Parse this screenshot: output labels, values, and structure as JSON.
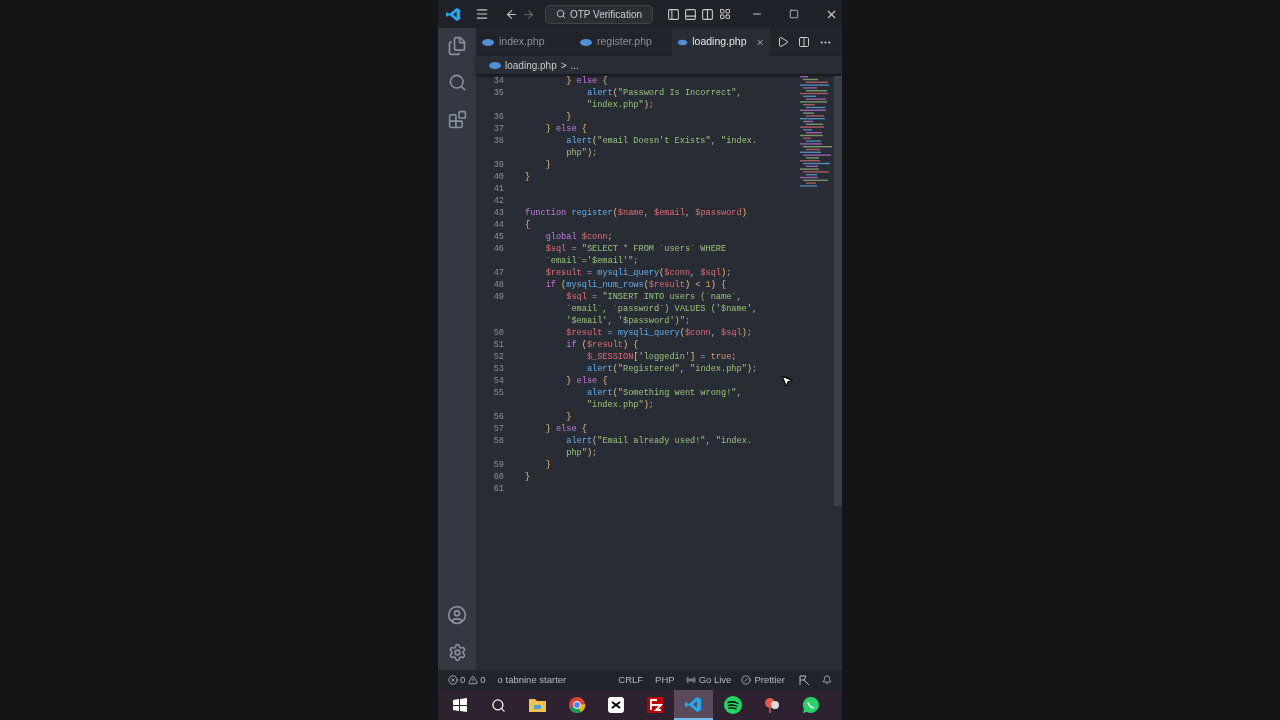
{
  "title_bar": {
    "search": "OTP Verification"
  },
  "tabs": [
    {
      "label": "index.php",
      "selected": false
    },
    {
      "label": "register.php",
      "selected": false
    },
    {
      "label": "loading.php",
      "selected": true
    }
  ],
  "breadcrumb": {
    "file": "loading.php",
    "separator": ">",
    "rest": "..."
  },
  "code_lines": [
    {
      "number": "34",
      "tokens": [
        {
          "kind": "bracket",
          "text": "        } "
        },
        {
          "kind": "keyword",
          "text": "else"
        },
        {
          "kind": "bracket",
          "text": " {"
        }
      ]
    },
    {
      "number": "35",
      "tokens": [
        {
          "kind": "function",
          "text": "            alert"
        },
        {
          "kind": "bracket",
          "text": "("
        },
        {
          "kind": "string",
          "text": "\"Password Is Incorrect\""
        },
        {
          "kind": "punct",
          "text": ","
        }
      ]
    },
    {
      "tokens": [
        {
          "kind": "string",
          "text": "            \"index.php\""
        },
        {
          "kind": "bracket",
          "text": ")"
        },
        {
          "kind": "punct",
          "text": ";"
        }
      ]
    },
    {
      "number": "36",
      "tokens": [
        {
          "kind": "bracket",
          "text": "        }"
        }
      ]
    },
    {
      "number": "37",
      "tokens": [
        {
          "kind": "bracket",
          "text": "    } "
        },
        {
          "kind": "keyword",
          "text": "else"
        },
        {
          "kind": "bracket",
          "text": " {"
        }
      ]
    },
    {
      "number": "38",
      "tokens": [
        {
          "kind": "function",
          "text": "        alert"
        },
        {
          "kind": "bracket",
          "text": "("
        },
        {
          "kind": "string",
          "text": "\"email Doesn't Exists\""
        },
        {
          "kind": "punct",
          "text": ", "
        },
        {
          "kind": "string",
          "text": "\"index."
        }
      ]
    },
    {
      "tokens": [
        {
          "kind": "string",
          "text": "        php\""
        },
        {
          "kind": "bracket",
          "text": ")"
        },
        {
          "kind": "punct",
          "text": ";"
        }
      ]
    },
    {
      "number": "39",
      "tokens": [
        {
          "kind": "bracket",
          "text": "    }"
        }
      ]
    },
    {
      "number": "40",
      "tokens": [
        {
          "kind": "bracket",
          "text": "}"
        }
      ]
    },
    {
      "number": "41"
    },
    {
      "number": "42"
    },
    {
      "number": "43",
      "tokens": [
        {
          "kind": "keyword",
          "text": "function "
        },
        {
          "kind": "function",
          "text": "register"
        },
        {
          "kind": "bracket",
          "text": "("
        },
        {
          "kind": "variable",
          "text": "$name"
        },
        {
          "kind": "punct",
          "text": ", "
        },
        {
          "kind": "variable",
          "text": "$email"
        },
        {
          "kind": "punct",
          "text": ", "
        },
        {
          "kind": "variable",
          "text": "$password"
        },
        {
          "kind": "bracket",
          "text": ")"
        }
      ]
    },
    {
      "number": "44",
      "tokens": [
        {
          "kind": "bracket",
          "text": "{"
        }
      ]
    },
    {
      "number": "45",
      "tokens": [
        {
          "kind": "keyword",
          "text": "    global "
        },
        {
          "kind": "variable",
          "text": "$conn"
        },
        {
          "kind": "punct",
          "text": ";"
        }
      ]
    },
    {
      "number": "46",
      "tokens": [
        {
          "kind": "variable",
          "text": "    $sql"
        },
        {
          "kind": "punct",
          "text": " = "
        },
        {
          "kind": "string",
          "text": "\"SELECT * FROM `users` WHERE"
        }
      ]
    },
    {
      "tokens": [
        {
          "kind": "string",
          "text": "    `email`='$email'\""
        },
        {
          "kind": "punct",
          "text": ";"
        }
      ]
    },
    {
      "number": "47",
      "tokens": [
        {
          "kind": "variable",
          "text": "    $result"
        },
        {
          "kind": "punct",
          "text": " = "
        },
        {
          "kind": "function",
          "text": "mysqli_query"
        },
        {
          "kind": "bracket",
          "text": "("
        },
        {
          "kind": "variable",
          "text": "$conn"
        },
        {
          "kind": "punct",
          "text": ", "
        },
        {
          "kind": "variable",
          "text": "$sql"
        },
        {
          "kind": "bracket",
          "text": ")"
        },
        {
          "kind": "punct",
          "text": ";"
        }
      ]
    },
    {
      "number": "48",
      "tokens": [
        {
          "kind": "keyword",
          "text": "    if "
        },
        {
          "kind": "bracket",
          "text": "("
        },
        {
          "kind": "function",
          "text": "mysqli_num_rows"
        },
        {
          "kind": "bracket",
          "text": "("
        },
        {
          "kind": "variable",
          "text": "$result"
        },
        {
          "kind": "bracket",
          "text": ")"
        },
        {
          "kind": "punct",
          "text": " < "
        },
        {
          "kind": "constant",
          "text": "1"
        },
        {
          "kind": "bracket",
          "text": ") {"
        }
      ]
    },
    {
      "number": "49",
      "tokens": [
        {
          "kind": "variable",
          "text": "        $sql"
        },
        {
          "kind": "punct",
          "text": " = "
        },
        {
          "kind": "string",
          "text": "\"INSERT INTO users (`name`,"
        }
      ]
    },
    {
      "tokens": [
        {
          "kind": "string",
          "text": "        `email`, `password`) VALUES ('$name',"
        }
      ]
    },
    {
      "tokens": [
        {
          "kind": "string",
          "text": "        '$email', '$password')\""
        },
        {
          "kind": "punct",
          "text": ";"
        }
      ]
    },
    {
      "number": "50",
      "tokens": [
        {
          "kind": "variable",
          "text": "        $result"
        },
        {
          "kind": "punct",
          "text": " = "
        },
        {
          "kind": "function",
          "text": "mysqli_query"
        },
        {
          "kind": "bracket",
          "text": "("
        },
        {
          "kind": "variable",
          "text": "$conn"
        },
        {
          "kind": "punct",
          "text": ", "
        },
        {
          "kind": "variable",
          "text": "$sql"
        },
        {
          "kind": "bracket",
          "text": ")"
        },
        {
          "kind": "punct",
          "text": ";"
        }
      ]
    },
    {
      "number": "51",
      "tokens": [
        {
          "kind": "keyword",
          "text": "        if "
        },
        {
          "kind": "bracket",
          "text": "("
        },
        {
          "kind": "variable",
          "text": "$result"
        },
        {
          "kind": "bracket",
          "text": ") {"
        }
      ]
    },
    {
      "number": "52",
      "tokens": [
        {
          "kind": "variable",
          "text": "            $_SESSION"
        },
        {
          "kind": "bracket",
          "text": "["
        },
        {
          "kind": "string",
          "text": "'loggedin'"
        },
        {
          "kind": "bracket",
          "text": "]"
        },
        {
          "kind": "punct",
          "text": " = "
        },
        {
          "kind": "constant",
          "text": "true"
        },
        {
          "kind": "punct",
          "text": ";"
        }
      ]
    },
    {
      "number": "53",
      "tokens": [
        {
          "kind": "function",
          "text": "            alert"
        },
        {
          "kind": "bracket",
          "text": "("
        },
        {
          "kind": "string",
          "text": "\"Registered\""
        },
        {
          "kind": "punct",
          "text": ", "
        },
        {
          "kind": "string",
          "text": "\"index.php\""
        },
        {
          "kind": "bracket",
          "text": ")"
        },
        {
          "kind": "punct",
          "text": ";"
        }
      ]
    },
    {
      "number": "54",
      "tokens": [
        {
          "kind": "bracket",
          "text": "        } "
        },
        {
          "kind": "keyword",
          "text": "else"
        },
        {
          "kind": "bracket",
          "text": " {"
        }
      ]
    },
    {
      "number": "55",
      "tokens": [
        {
          "kind": "function",
          "text": "            alert"
        },
        {
          "kind": "bracket",
          "text": "("
        },
        {
          "kind": "string",
          "text": "\"Something went wrong!\""
        },
        {
          "kind": "punct",
          "text": ","
        }
      ]
    },
    {
      "tokens": [
        {
          "kind": "string",
          "text": "            \"index.php\""
        },
        {
          "kind": "bracket",
          "text": ")"
        },
        {
          "kind": "punct",
          "text": ";"
        }
      ]
    },
    {
      "number": "56",
      "tokens": [
        {
          "kind": "bracket",
          "text": "        }"
        }
      ]
    },
    {
      "number": "57",
      "tokens": [
        {
          "kind": "bracket",
          "text": "    } "
        },
        {
          "kind": "keyword",
          "text": "else"
        },
        {
          "kind": "bracket",
          "text": " {"
        }
      ]
    },
    {
      "number": "58",
      "tokens": [
        {
          "kind": "function",
          "text": "        alert"
        },
        {
          "kind": "bracket",
          "text": "("
        },
        {
          "kind": "string",
          "text": "\"Email already used!\""
        },
        {
          "kind": "punct",
          "text": ", "
        },
        {
          "kind": "string",
          "text": "\"index."
        }
      ]
    },
    {
      "tokens": [
        {
          "kind": "string",
          "text": "        php\""
        },
        {
          "kind": "bracket",
          "text": ")"
        },
        {
          "kind": "punct",
          "text": ";"
        }
      ]
    },
    {
      "number": "59",
      "tokens": [
        {
          "kind": "bracket",
          "text": "    }"
        }
      ]
    },
    {
      "number": "60",
      "tokens": [
        {
          "kind": "bracket",
          "text": "}"
        }
      ]
    },
    {
      "number": "61"
    }
  ],
  "status_bar": {
    "errors": "0",
    "warnings": "0",
    "tabnine": "o tabnine starter",
    "line_ending": "CRLF",
    "language": "PHP",
    "go_live": "Go Live",
    "prettier": "Prettier"
  },
  "taskbar": [
    {
      "kind": "windows",
      "selected": false
    },
    {
      "kind": "search",
      "selected": false
    },
    {
      "kind": "folder",
      "selected": false
    },
    {
      "kind": "browser",
      "selected": false
    },
    {
      "kind": "video-editor",
      "selected": false
    },
    {
      "kind": "ftp",
      "selected": false
    },
    {
      "kind": "editor",
      "selected": true
    },
    {
      "kind": "music",
      "selected": false
    },
    {
      "kind": "paint",
      "selected": false
    },
    {
      "kind": "chat",
      "selected": false
    }
  ]
}
